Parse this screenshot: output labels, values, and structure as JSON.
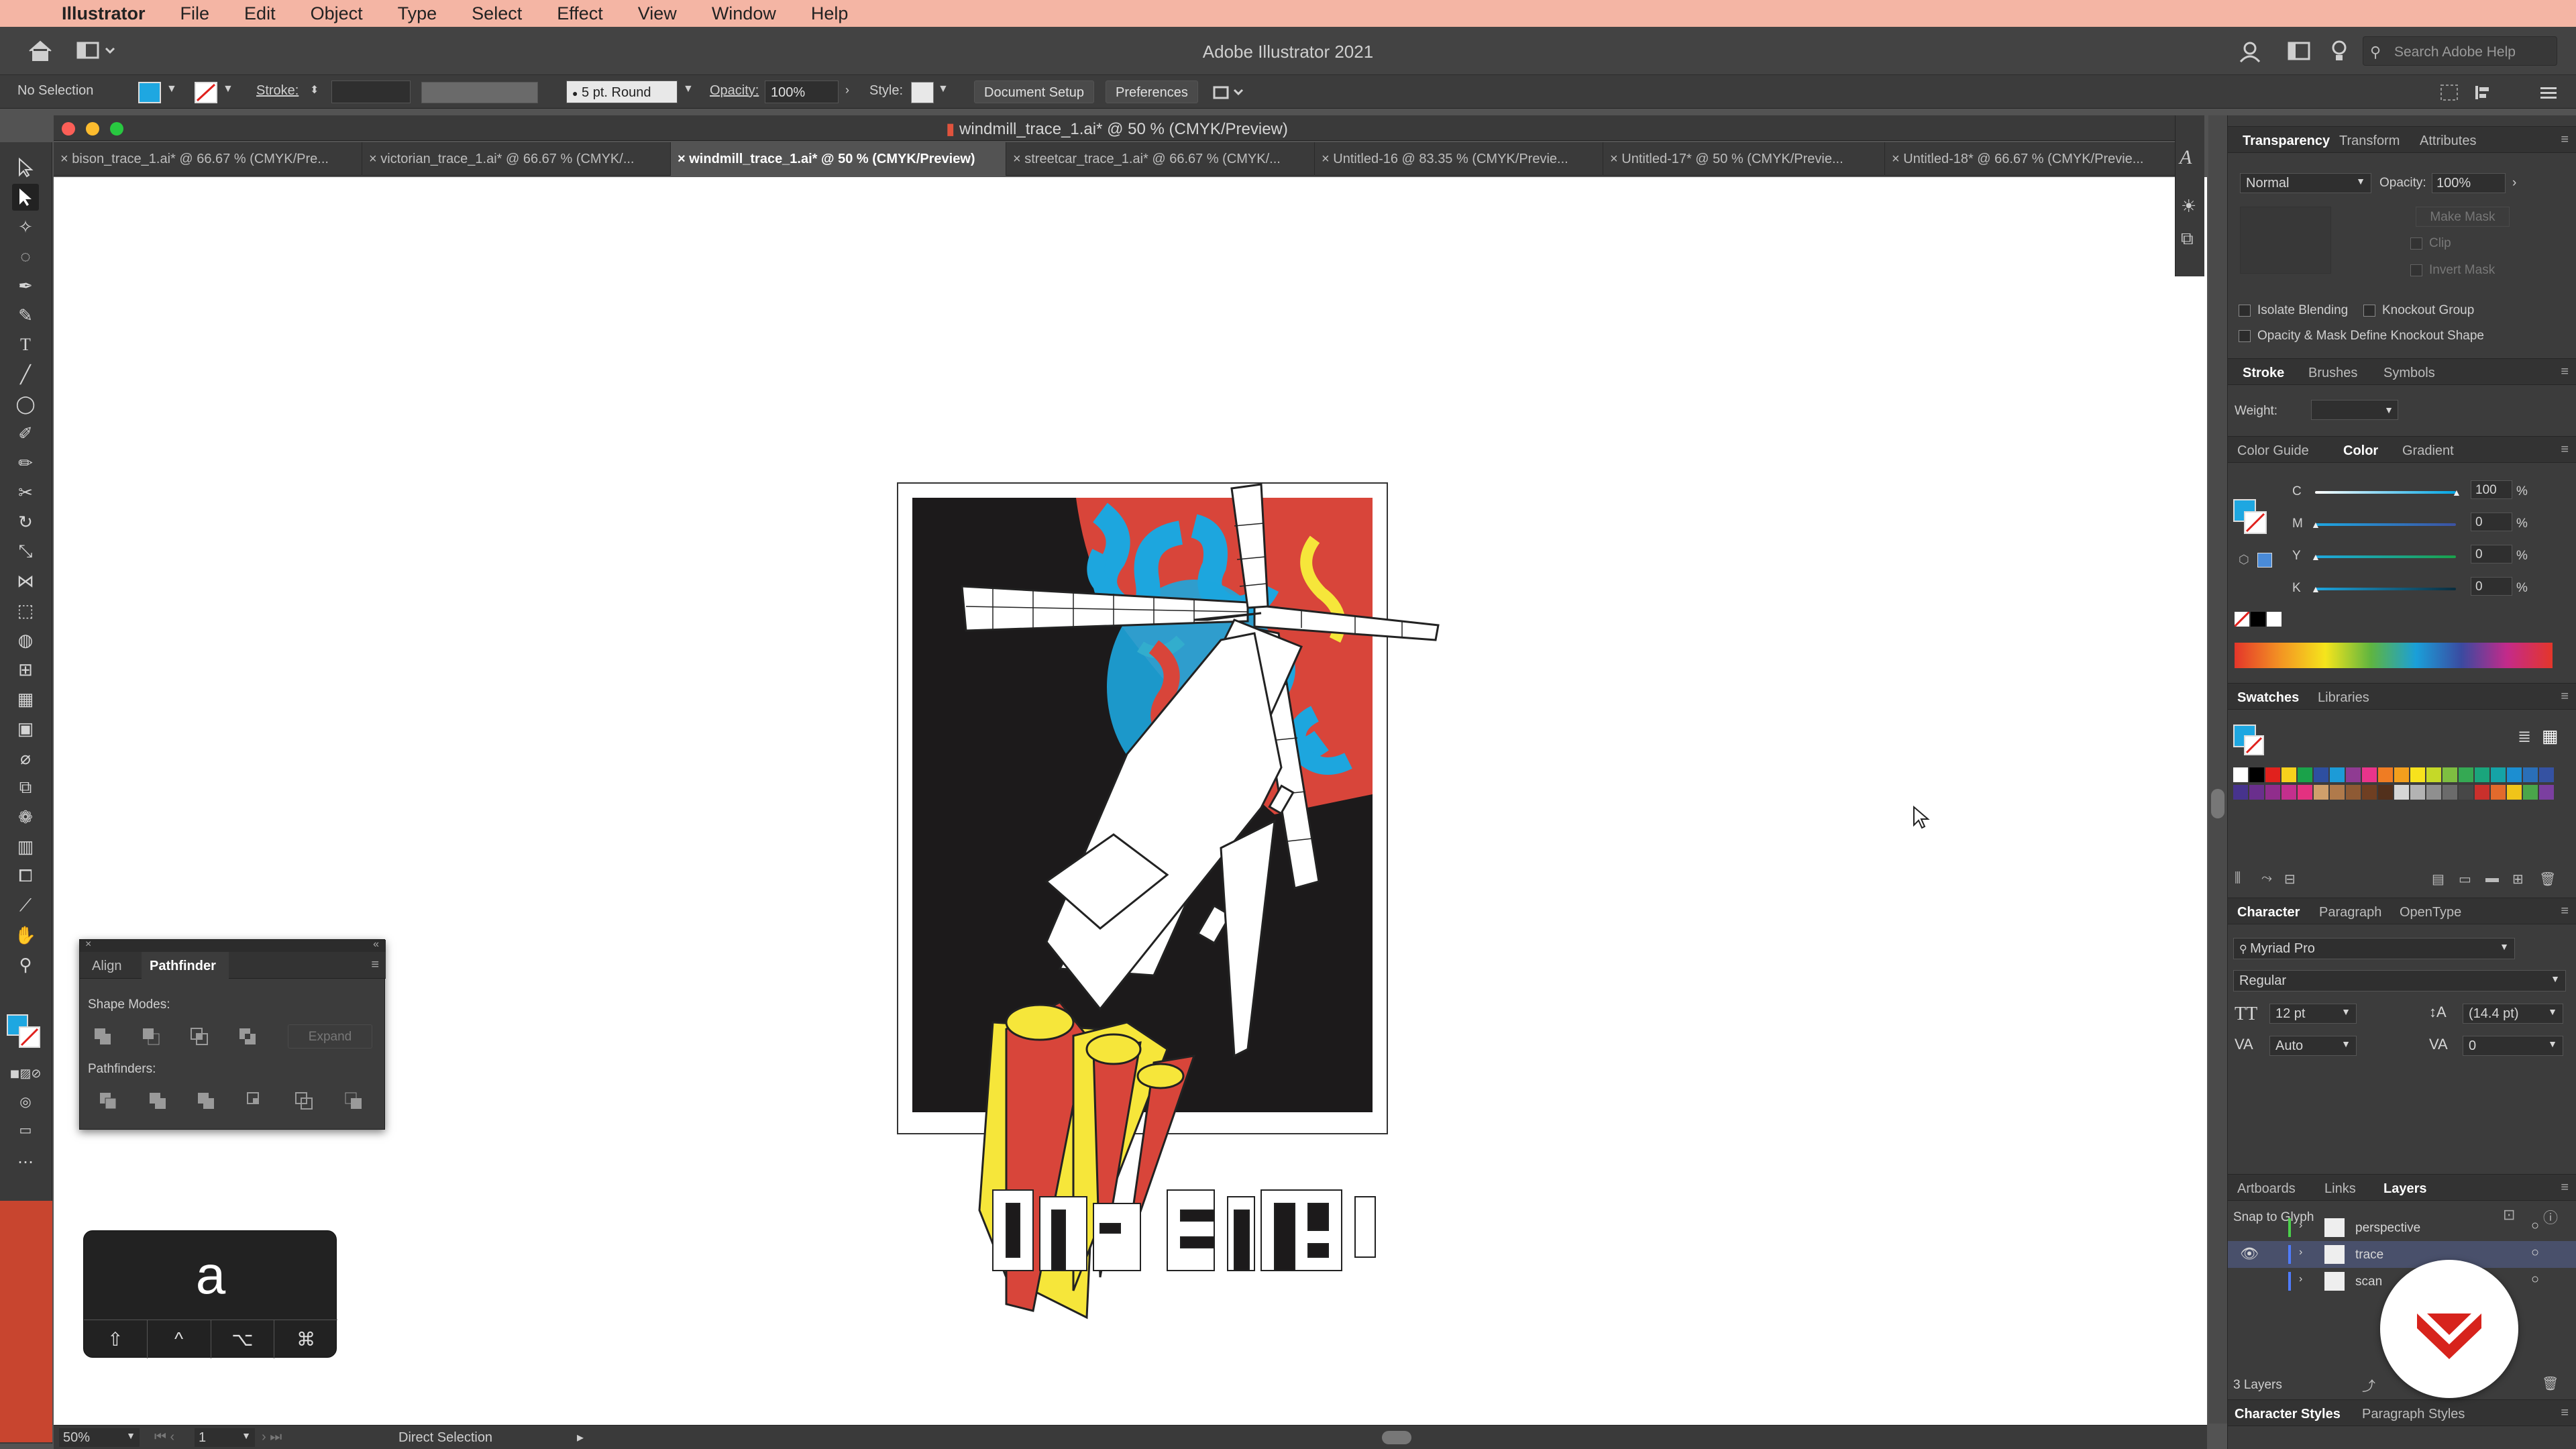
{
  "menubar": {
    "app_name": "Illustrator",
    "items": [
      "File",
      "Edit",
      "Object",
      "Type",
      "Select",
      "Effect",
      "View",
      "Window",
      "Help"
    ]
  },
  "titlebar": {
    "title": "Adobe Illustrator 2021",
    "search_placeholder": "Search Adobe Help"
  },
  "control": {
    "selection": "No Selection",
    "stroke_label": "Stroke:",
    "brush": "5 pt. Round",
    "opacity_label": "Opacity:",
    "opacity_value": "100%",
    "style_label": "Style:",
    "document_setup": "Document Setup",
    "preferences": "Preferences"
  },
  "document": {
    "window_title": "windmill_trace_1.ai* @ 50 % (CMYK/Preview)",
    "tabs": [
      {
        "label": "bison_trace_1.ai* @ 66.67 % (CMYK/Pre...",
        "active": false
      },
      {
        "label": "victorian_trace_1.ai* @ 66.67 % (CMYK/...",
        "active": false
      },
      {
        "label": "windmill_trace_1.ai* @ 50 % (CMYK/Preview)",
        "active": true
      },
      {
        "label": "streetcar_trace_1.ai* @ 66.67 % (CMYK/...",
        "active": false
      },
      {
        "label": "Untitled-16 @ 83.35 % (CMYK/Previe...",
        "active": false
      },
      {
        "label": "Untitled-17* @ 50 % (CMYK/Previe...",
        "active": false
      },
      {
        "label": "Untitled-18* @ 66.67 % (CMYK/Previe...",
        "active": false
      }
    ]
  },
  "pathfinder": {
    "tab_align": "Align",
    "tab_pathfinder": "Pathfinder",
    "shape_modes": "Shape Modes:",
    "expand": "Expand",
    "pathfinders": "Pathfinders:"
  },
  "keydisplay": {
    "key": "a",
    "modifiers": [
      "⇧",
      "^",
      "⌥",
      "⌘"
    ]
  },
  "status": {
    "zoom": "50%",
    "artboard": "1",
    "tool": "Direct Selection"
  },
  "transparency": {
    "tabs": [
      "Transparency",
      "Transform",
      "Attributes"
    ],
    "blend_mode": "Normal",
    "opacity_label": "Opacity:",
    "opacity_value": "100%",
    "make_mask": "Make Mask",
    "clip": "Clip",
    "invert_mask": "Invert Mask",
    "isolate_blending": "Isolate Blending",
    "knockout_group": "Knockout Group",
    "opacity_mask": "Opacity & Mask Define Knockout Shape"
  },
  "stroke_panel": {
    "tabs": [
      "Stroke",
      "Brushes",
      "Symbols"
    ],
    "weight_label": "Weight:"
  },
  "color_panel": {
    "tabs": [
      "Color Guide",
      "Color",
      "Gradient"
    ],
    "channels": [
      {
        "name": "C",
        "value": "100",
        "level": 1.0
      },
      {
        "name": "M",
        "value": "0",
        "level": 0.0
      },
      {
        "name": "Y",
        "value": "0",
        "level": 0.0
      },
      {
        "name": "K",
        "value": "0",
        "level": 0.0
      }
    ],
    "percent": "%"
  },
  "swatches": {
    "tabs": [
      "Swatches",
      "Libraries"
    ],
    "colors": [
      "#ffffff",
      "#000000",
      "#e1211d",
      "#f6d11c",
      "#1aa24a",
      "#2e4fa0",
      "#1c9bd7",
      "#8f3b92",
      "#e9348b",
      "#ef7c23",
      "#f39f1d",
      "#f7e21d",
      "#c5d928",
      "#7ebe41",
      "#35a953",
      "#1aa57c",
      "#15a3a6",
      "#1c8ed1",
      "#2a6fb8",
      "#3552a2",
      "#47338d",
      "#6a2f8d",
      "#902d8c",
      "#c32f8d",
      "#e33180",
      "#d0a06b",
      "#b07a4b",
      "#8e5a34",
      "#6f3f22",
      "#52301c",
      "#d6d6d6",
      "#b3b3b3",
      "#8f8f8f",
      "#6b6b6b",
      "#474747",
      "#c9302c",
      "#e26a2c",
      "#f0c419",
      "#4aa64a",
      "#7b3fa0"
    ]
  },
  "character": {
    "tabs": [
      "Character",
      "Paragraph",
      "OpenType"
    ],
    "font": "Myriad Pro",
    "style": "Regular",
    "size": "12 pt",
    "leading": "(14.4 pt)",
    "kerning": "Auto",
    "tracking": "0",
    "snap": "Snap to Glyph"
  },
  "layers": {
    "tabs": [
      "Artboards",
      "Links",
      "Layers"
    ],
    "items": [
      {
        "name": "perspective",
        "color": "#4bd04b"
      },
      {
        "name": "trace",
        "color": "#4f7cff"
      },
      {
        "name": "scan",
        "color": "#4f7cff"
      }
    ],
    "count": "3 Layers"
  },
  "bottom_tabs": [
    "Character Styles",
    "Paragraph Styles"
  ],
  "colors": {
    "accent_fill": "#1ea7e1",
    "poster_red": "#d8453a",
    "poster_yellow": "#f6e63a",
    "poster_blue": "#1da6de"
  }
}
